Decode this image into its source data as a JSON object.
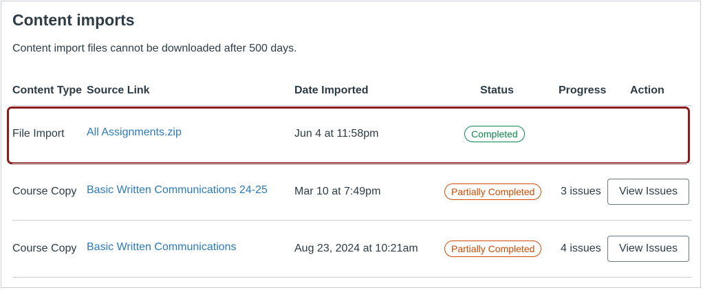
{
  "title": "Content imports",
  "note": "Content import files cannot be downloaded after 500 days.",
  "columns": {
    "content_type": "Content Type",
    "source_link": "Source Link",
    "date_imported": "Date Imported",
    "status": "Status",
    "progress": "Progress",
    "action": "Action"
  },
  "rows": [
    {
      "content_type": "File Import",
      "source_link": "All Assignments.zip",
      "date_imported": "Jun 4 at 11:58pm",
      "status": "Completed",
      "status_color": "#0b874b",
      "progress": "",
      "action": "",
      "highlighted": true
    },
    {
      "content_type": "Course Copy",
      "source_link": "Basic Written Communications 24-25",
      "date_imported": "Mar 10 at 7:49pm",
      "status": "Partially Completed",
      "status_color": "#cf4a00",
      "progress": "3 issues",
      "action": "View Issues"
    },
    {
      "content_type": "Course Copy",
      "source_link": "Basic Written Communications",
      "date_imported": "Aug 23, 2024 at 10:21am",
      "status": "Partially Completed",
      "status_color": "#cf4a00",
      "progress": "4 issues",
      "action": "View Issues"
    }
  ],
  "colors": {
    "link": "#2b7abc",
    "highlight_border": "#8b1a1a",
    "text": "#2d3b45"
  }
}
